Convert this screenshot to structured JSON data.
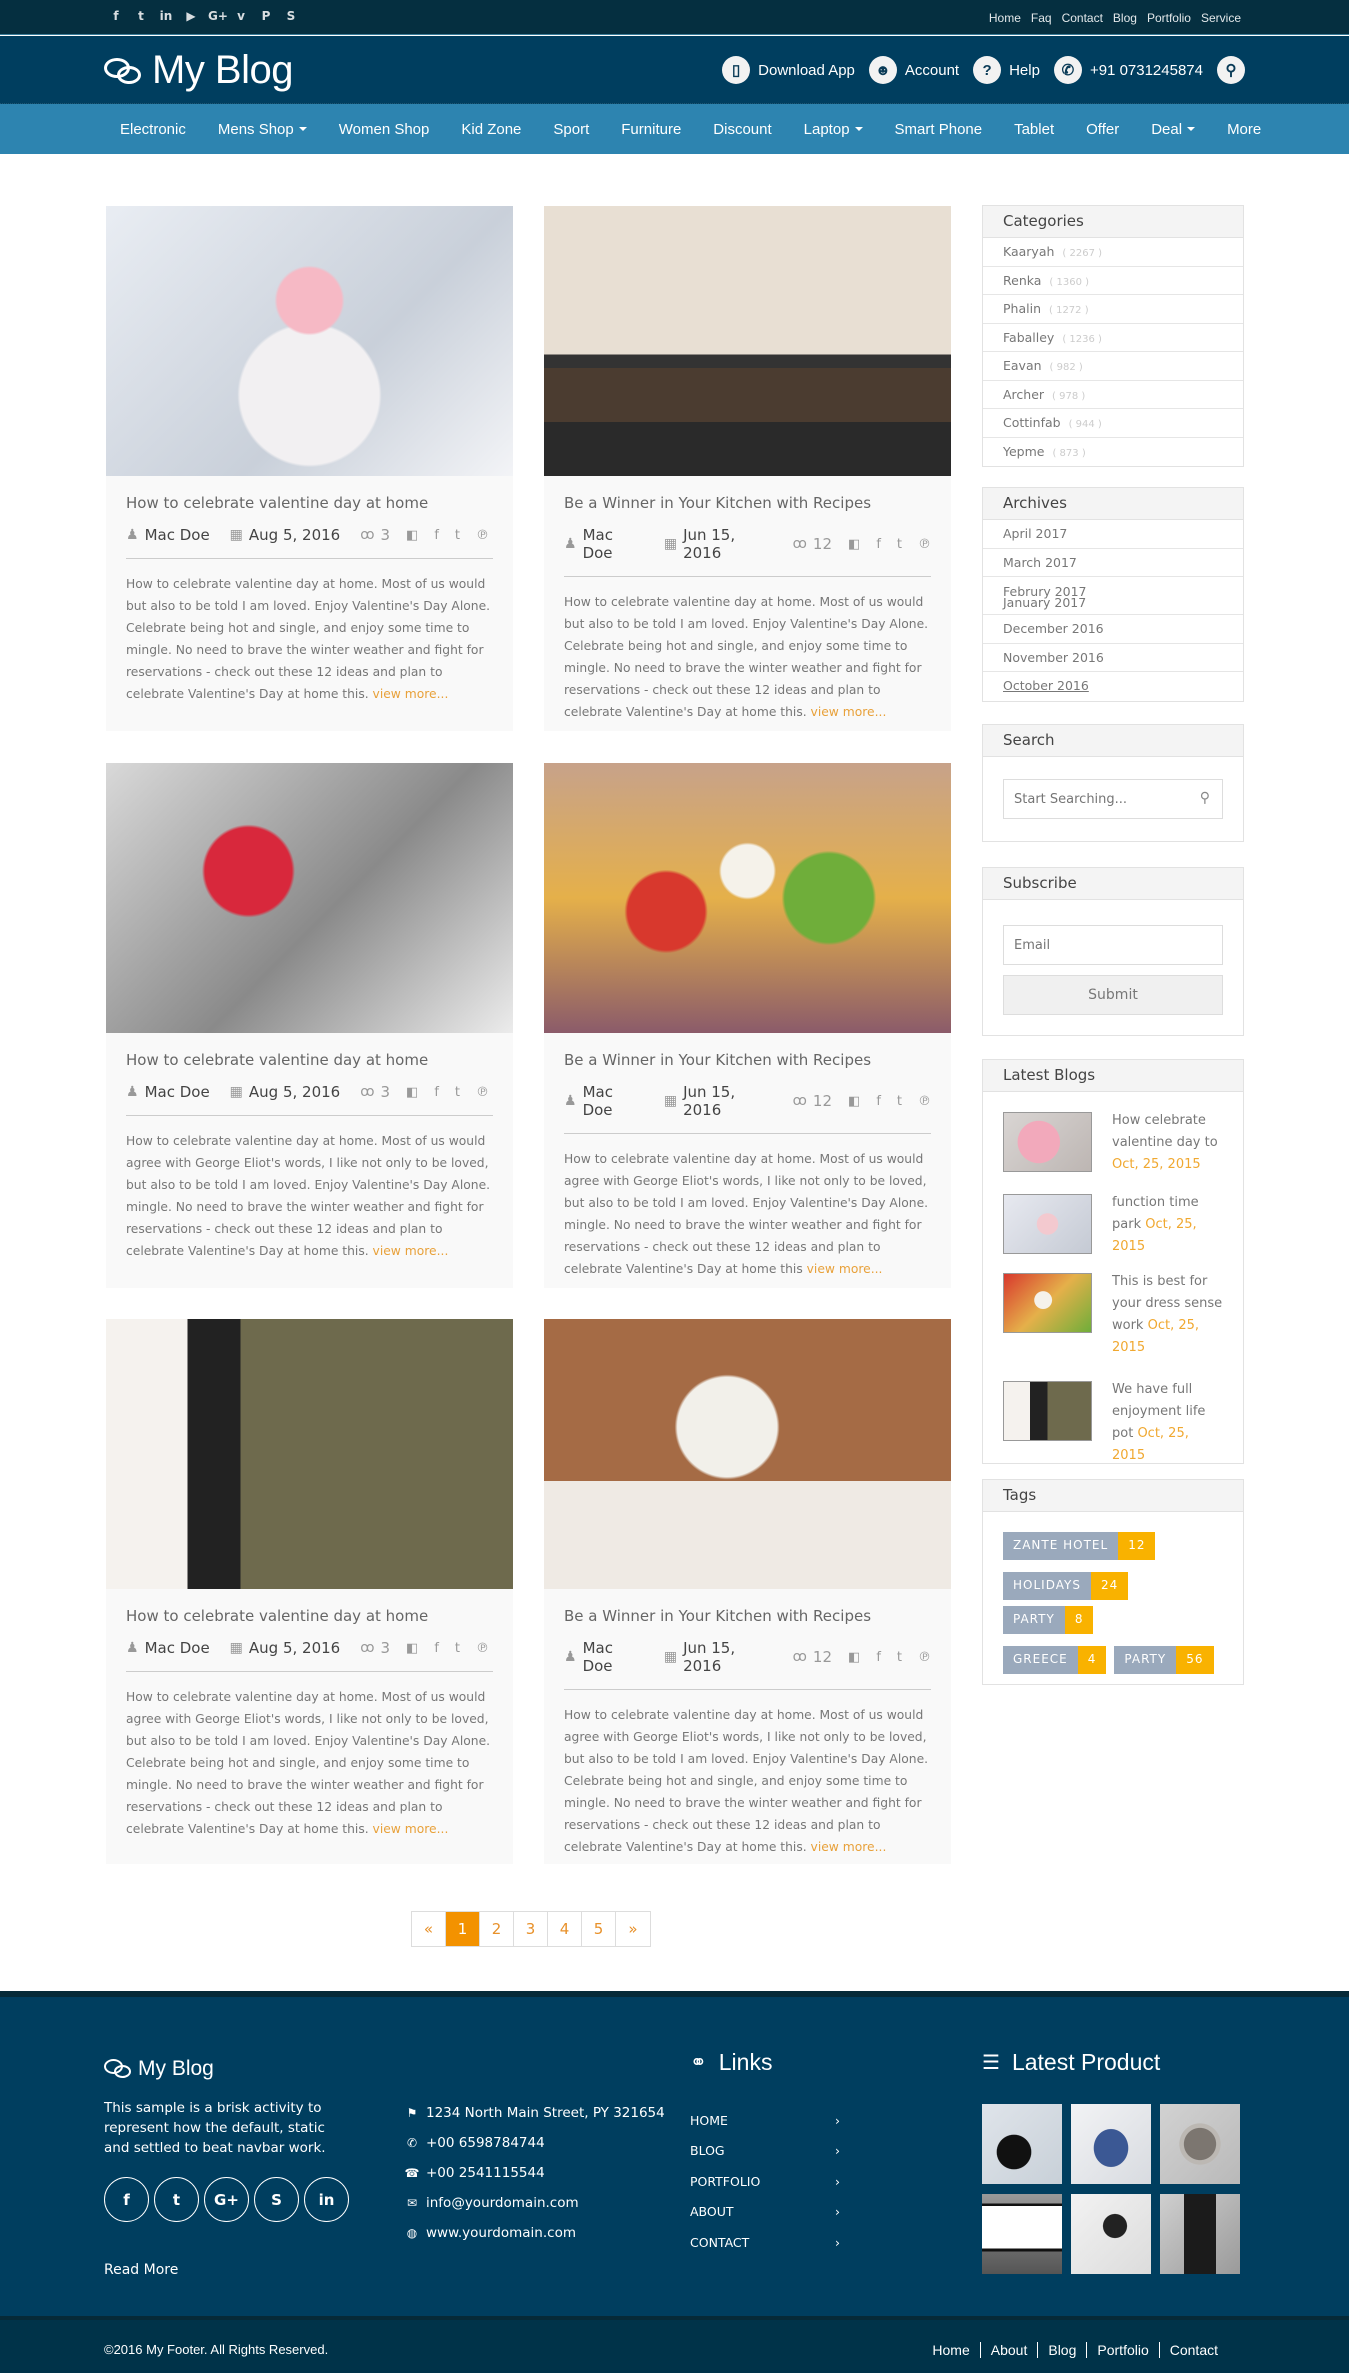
{
  "topbar": {
    "social": [
      {
        "name": "facebook-icon",
        "glyph": "f"
      },
      {
        "name": "twitter-icon",
        "glyph": "t"
      },
      {
        "name": "linkedin-icon",
        "glyph": "in"
      },
      {
        "name": "youtube-icon",
        "glyph": "▶"
      },
      {
        "name": "google-plus-icon",
        "glyph": "G+"
      },
      {
        "name": "vimeo-icon",
        "glyph": "v"
      },
      {
        "name": "pinterest-icon",
        "glyph": "P"
      },
      {
        "name": "skype-icon",
        "glyph": "S"
      }
    ],
    "links": [
      "Home",
      "Faq",
      "Contact",
      "Blog",
      "Portfolio",
      "Service"
    ]
  },
  "header": {
    "title": "My Blog",
    "actions": [
      {
        "label": "Download App",
        "icon": "▯",
        "icon_name": "mobile-icon"
      },
      {
        "label": "Account",
        "icon": "☻",
        "icon_name": "user-icon"
      },
      {
        "label": "Help",
        "icon": "?",
        "icon_name": "help-icon"
      },
      {
        "label": "+91 0731245874",
        "icon": "✆",
        "icon_name": "phone-icon"
      }
    ],
    "search_icon": "⚲"
  },
  "nav": [
    {
      "label": "Electronic",
      "dropdown": false
    },
    {
      "label": "Mens Shop",
      "dropdown": true
    },
    {
      "label": "Women Shop",
      "dropdown": false
    },
    {
      "label": "Kid Zone",
      "dropdown": false
    },
    {
      "label": "Sport",
      "dropdown": false
    },
    {
      "label": "Furniture",
      "dropdown": false
    },
    {
      "label": "Discount",
      "dropdown": false
    },
    {
      "label": "Laptop",
      "dropdown": true
    },
    {
      "label": "Smart Phone",
      "dropdown": false
    },
    {
      "label": "Tablet",
      "dropdown": false
    },
    {
      "label": "Offer",
      "dropdown": false
    },
    {
      "label": "Deal",
      "dropdown": true
    },
    {
      "label": "More",
      "dropdown": false
    }
  ],
  "posts": [
    {
      "title": "How to celebrate valentine day at home",
      "author": "Mac Doe",
      "date": "Aug 5, 2016",
      "comments": "3",
      "image": "woman-snow-hearts",
      "excerpt": "How to celebrate valentine day at home. Most of us would but also to be told I am loved. Enjoy Valentine's Day Alone. Celebrate being hot and single, and enjoy some time to mingle. No need to brave the winter weather and fight for reservations - check out these 12 ideas and plan to celebrate Valentine's Day at home this.",
      "more": "view more..."
    },
    {
      "title": "Be a Winner in Your Kitchen with Recipes",
      "author": "Mac Doe",
      "date": "Jun 15, 2016",
      "comments": "12",
      "image": "couple-cooking",
      "excerpt": "How to celebrate valentine day at home. Most of us would but also to be told I am loved. Enjoy Valentine's Day Alone. Celebrate being hot and single, and enjoy some time to mingle. No need to brave the winter weather and fight for reservations - check out these 12 ideas and plan to celebrate Valentine's Day at home this.",
      "more": "view more..."
    },
    {
      "title": "How to celebrate valentine day at home",
      "author": "Mac Doe",
      "date": "Aug 5, 2016",
      "comments": "3",
      "image": "red-heart-tree",
      "excerpt": "How to celebrate valentine day at home. Most of us would agree with George Eliot's words, I like not only to be loved, but also to be told I am loved. Enjoy Valentine's Day Alone. mingle. No need to brave the winter weather and fight for reservations - check out these 12 ideas and plan to celebrate Valentine's Day at home this.",
      "more": "view more..."
    },
    {
      "title": "Be a Winner in Your Kitchen with Recipes",
      "author": "Mac Doe",
      "date": "Jun 15, 2016",
      "comments": "12",
      "image": "salad-plate",
      "excerpt": "How to celebrate valentine day at home. Most of us would agree with George Eliot's words, I like not only to be loved, but also to be told I am loved. Enjoy Valentine's Day Alone. mingle. No need to brave the winter weather and fight for reservations - check out these 12 ideas and plan to celebrate Valentine's Day at home this",
      "more": "view more..."
    },
    {
      "title": "How to celebrate valentine day at home",
      "author": "Mac Doe",
      "date": "Aug 5, 2016",
      "comments": "3",
      "image": "wedding-couple",
      "excerpt": "How to celebrate valentine day at home. Most of us would agree with George Eliot's words, I like not only to be loved, but also to be told I am loved. Enjoy Valentine's Day Alone. Celebrate being hot and single, and enjoy some time to mingle. No need to brave the winter weather and fight for reservations - check out these 12 ideas and plan to celebrate Valentine's Day at home this.",
      "more": "view more..."
    },
    {
      "title": "Be a Winner in Your Kitchen with Recipes",
      "author": "Mac Doe",
      "date": "Jun 15, 2016",
      "comments": "12",
      "image": "baby-basket",
      "excerpt": "How to celebrate valentine day at home. Most of us would agree with George Eliot's words, I like not only to be loved, but also to be told I am loved. Enjoy Valentine's Day Alone. Celebrate being hot and single, and enjoy some time to mingle. No need to brave the winter weather and fight for reservations - check out these 12 ideas and plan to celebrate Valentine's Day at home this.",
      "more": "view more..."
    }
  ],
  "pagination": {
    "prev": "«",
    "pages": [
      "1",
      "2",
      "3",
      "4",
      "5"
    ],
    "next": "»",
    "active": "1"
  },
  "sidebar": {
    "categories": {
      "title": "Categories",
      "items": [
        {
          "name": "Kaaryah",
          "count": "( 2267 )"
        },
        {
          "name": "Renka",
          "count": "( 1360 )"
        },
        {
          "name": "Phalin",
          "count": "( 1272 )"
        },
        {
          "name": "Faballey",
          "count": "( 1236 )"
        },
        {
          "name": "Eavan",
          "count": "( 982 )"
        },
        {
          "name": "Archer",
          "count": "( 978 )"
        },
        {
          "name": "Cottinfab",
          "count": "( 944 )"
        },
        {
          "name": "Yepme",
          "count": "( 873 )"
        }
      ]
    },
    "archives": {
      "title": "Archives",
      "items": [
        "April 2017",
        "March 2017",
        "Februry 2017",
        "January 2017",
        "December 2016",
        "November 2016",
        "October 2016"
      ]
    },
    "search": {
      "title": "Search",
      "placeholder": "Start Searching..."
    },
    "subscribe": {
      "title": "Subscribe",
      "placeholder": "Email",
      "button": "Submit"
    },
    "latest": {
      "title": "Latest Blogs",
      "items": [
        {
          "text": "How celebrate valentine day to",
          "date": "Oct, 25, 2015",
          "image": "pink-flowers"
        },
        {
          "text": "function time park",
          "date": "Oct, 25, 2015",
          "image": "woman-hearts"
        },
        {
          "text": "This is best for your dress sense work",
          "date": "Oct, 25, 2015",
          "image": "salad"
        },
        {
          "text": "We have full enjoyment life pot",
          "date": "Oct, 25, 2015",
          "image": "wedding"
        }
      ]
    },
    "tags": {
      "title": "Tags",
      "items": [
        {
          "name": "ZANTE HOTEL",
          "count": "12"
        },
        {
          "name": "HOLIDAYS",
          "count": "24"
        },
        {
          "name": "PARTY",
          "count": "8"
        },
        {
          "name": "GREECE",
          "count": "4"
        },
        {
          "name": "PARTY",
          "count": "56"
        }
      ]
    }
  },
  "footer": {
    "logo": "My Blog",
    "description": "This sample is a brisk activity to represent how the default, static and settled to beat navbar work.",
    "social": [
      {
        "name": "facebook-icon",
        "glyph": "f"
      },
      {
        "name": "twitter-icon",
        "glyph": "t"
      },
      {
        "name": "google-plus-icon",
        "glyph": "G+"
      },
      {
        "name": "skype-icon",
        "glyph": "S"
      },
      {
        "name": "linkedin-icon",
        "glyph": "in"
      }
    ],
    "read_more": "Read More",
    "contact": [
      {
        "icon": "⚑",
        "icon_name": "map-marker-icon",
        "text": "1234 North Main Street, PY 321654"
      },
      {
        "icon": "✆",
        "icon_name": "phone-icon",
        "text": "+00 6598784744"
      },
      {
        "icon": "☎",
        "icon_name": "fax-icon",
        "text": "+00 2541115544"
      },
      {
        "icon": "✉",
        "icon_name": "envelope-icon",
        "text": "info@yourdomain.com"
      },
      {
        "icon": "◍",
        "icon_name": "globe-icon",
        "text": "www.yourdomain.com"
      }
    ],
    "links_title": "Links",
    "links": [
      "HOME",
      "BLOG",
      "PORTFOLIO",
      "ABOUT",
      "CONTACT"
    ],
    "products_title": "Latest Product",
    "products": [
      "camera",
      "sneakers",
      "watch",
      "monitor",
      "headphones",
      "blender"
    ],
    "copyright": "©2016 My Footer. All Rights Reserved.",
    "bottom_links": [
      "Home",
      "About",
      "Blog",
      "Portfolio",
      "Contact"
    ]
  },
  "colors": {
    "accent": "#f39200",
    "primary": "#003e5f",
    "nav": "#2d84b0",
    "link_orange": "#e8a13a",
    "tag_grey": "#9aa9bc",
    "tag_yellow": "#f9b200"
  }
}
